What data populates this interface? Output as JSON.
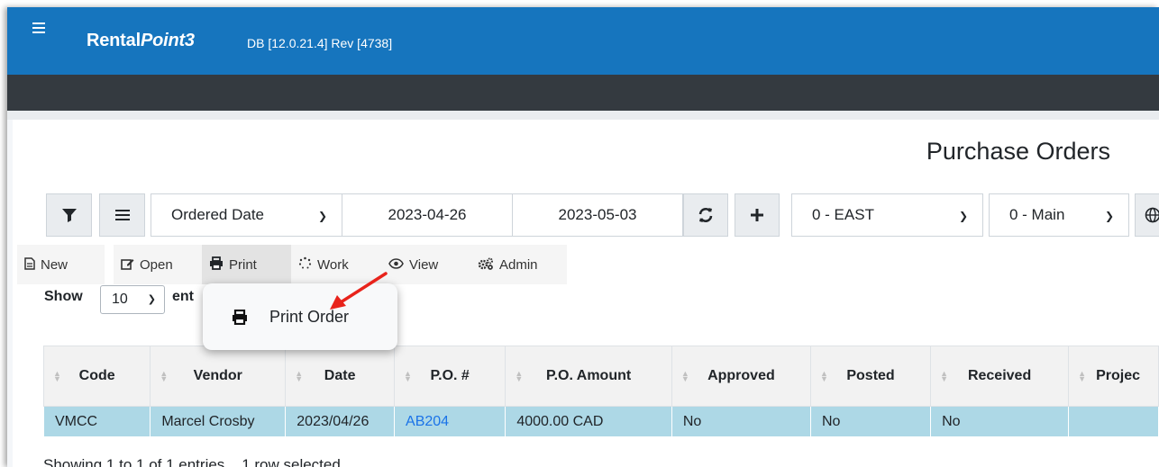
{
  "header": {
    "brand_prefix": "Rental",
    "brand_italic": "Point3",
    "db_info": "DB [12.0.21.4]   Rev [4738]"
  },
  "page": {
    "title": "Purchase Orders"
  },
  "filters": {
    "date_field": "Ordered Date",
    "start_date": "2023-04-26",
    "end_date": "2023-05-03",
    "location": "0 - EAST",
    "store": "0 - Main"
  },
  "toolbar": {
    "new": "New",
    "open": "Open",
    "print": "Print",
    "work": "Work",
    "view": "View",
    "admin": "Admin"
  },
  "length": {
    "show": "Show",
    "value": "10",
    "entries": "ent"
  },
  "print_menu": {
    "print_order": "Print Order"
  },
  "table": {
    "columns": [
      "Code",
      "Vendor",
      "Date",
      "P.O. #",
      "P.O. Amount",
      "Approved",
      "Posted",
      "Received",
      "Projec"
    ],
    "rows": [
      [
        "VMCC",
        "Marcel Crosby",
        "2023/04/26",
        "AB204",
        "4000.00 CAD",
        "No",
        "No",
        "No",
        ""
      ]
    ]
  },
  "footer": {
    "info": "Showing 1 to 1 of 1 entries",
    "selected": "1 row selected"
  },
  "colors": {
    "topbar": "#1675be",
    "darkbar": "#343a40",
    "selected_row": "#add8e6",
    "arrow": "#e8231b"
  }
}
